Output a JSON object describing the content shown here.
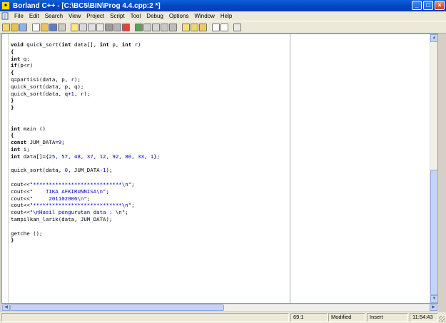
{
  "window": {
    "title": "Borland C++ - [C:\\BC5\\BIN\\Prog 4.4.cpp:2 *]"
  },
  "window_controls": {
    "minimize": "_",
    "maximize": "□",
    "close": "×"
  },
  "menu": [
    "File",
    "Edit",
    "Search",
    "View",
    "Project",
    "Script",
    "Tool",
    "Debug",
    "Options",
    "Window",
    "Help"
  ],
  "code_lines": [
    [
      {
        "t": "void",
        "c": "kw"
      },
      {
        "t": " quick_sort(",
        "c": ""
      },
      {
        "t": "int",
        "c": "kw"
      },
      {
        "t": " data[], ",
        "c": ""
      },
      {
        "t": "int",
        "c": "kw"
      },
      {
        "t": " p, ",
        "c": ""
      },
      {
        "t": "int",
        "c": "kw"
      },
      {
        "t": " r)",
        "c": ""
      }
    ],
    [
      {
        "t": "{",
        "c": "kw"
      }
    ],
    [
      {
        "t": "int",
        "c": "kw"
      },
      {
        "t": " q;",
        "c": ""
      }
    ],
    [
      {
        "t": "if",
        "c": "kw"
      },
      {
        "t": "(p<r)",
        "c": ""
      }
    ],
    [
      {
        "t": "{",
        "c": "kw"
      }
    ],
    [
      {
        "t": "q=partisi(data, p, r);",
        "c": ""
      }
    ],
    [
      {
        "t": "quick_sort(data, p, q);",
        "c": ""
      }
    ],
    [
      {
        "t": "quick_sort(data, q+",
        "c": ""
      },
      {
        "t": "1",
        "c": "num"
      },
      {
        "t": ", r);",
        "c": ""
      }
    ],
    [
      {
        "t": "}",
        "c": "kw"
      }
    ],
    [
      {
        "t": "}",
        "c": "kw"
      }
    ],
    [],
    [],
    [
      {
        "t": "int",
        "c": "kw"
      },
      {
        "t": " main ()",
        "c": ""
      }
    ],
    [
      {
        "t": "{",
        "c": "kw"
      }
    ],
    [
      {
        "t": "const",
        "c": "kw"
      },
      {
        "t": " JUM_DATA=",
        "c": ""
      },
      {
        "t": "9",
        "c": "num"
      },
      {
        "t": ";",
        "c": ""
      }
    ],
    [
      {
        "t": "int",
        "c": "kw"
      },
      {
        "t": " i;",
        "c": ""
      }
    ],
    [
      {
        "t": "int",
        "c": "kw"
      },
      {
        "t": " data[]={",
        "c": ""
      },
      {
        "t": "25, 57, 48, 37, 12, 92, 80, 33, 1",
        "c": "num"
      },
      {
        "t": "};",
        "c": ""
      }
    ],
    [],
    [
      {
        "t": "quick_sort(data, ",
        "c": ""
      },
      {
        "t": "0",
        "c": "num"
      },
      {
        "t": ", JUM_DATA-",
        "c": ""
      },
      {
        "t": "1",
        "c": "num"
      },
      {
        "t": ");",
        "c": ""
      }
    ],
    [],
    [
      {
        "t": "cout<<",
        "c": ""
      },
      {
        "t": "\"****************************\\n\"",
        "c": "str"
      },
      {
        "t": ";",
        "c": ""
      }
    ],
    [
      {
        "t": "cout<<",
        "c": ""
      },
      {
        "t": "\"    TIKA AFKIRUNNISA\\n\"",
        "c": "str"
      },
      {
        "t": ";",
        "c": ""
      }
    ],
    [
      {
        "t": "cout<<",
        "c": ""
      },
      {
        "t": "\"     201102006\\n\"",
        "c": "str"
      },
      {
        "t": ";",
        "c": ""
      }
    ],
    [
      {
        "t": "cout<<",
        "c": ""
      },
      {
        "t": "\"****************************\\n\"",
        "c": "str"
      },
      {
        "t": ";",
        "c": ""
      }
    ],
    [
      {
        "t": "cout<<",
        "c": ""
      },
      {
        "t": "\"\\nHasil pengurutan data : \\n\"",
        "c": "str"
      },
      {
        "t": ";",
        "c": ""
      }
    ],
    [
      {
        "t": "tampilkan_larik(data, JUM_DATA);",
        "c": ""
      }
    ],
    [],
    [
      {
        "t": "getche ();",
        "c": ""
      }
    ],
    [
      {
        "t": "}",
        "c": "kw"
      }
    ]
  ],
  "scrollbars": {
    "up": "▲",
    "down": "▼",
    "left": "◀",
    "right": "▶"
  },
  "status": {
    "position": "69:1",
    "modified": "Modified",
    "mode": "Insert",
    "time": "11:54:43"
  },
  "colors": {
    "keyword": "#000000",
    "string": "#0000c8",
    "number": "#0000c8",
    "title_bar": "#0347c4"
  }
}
